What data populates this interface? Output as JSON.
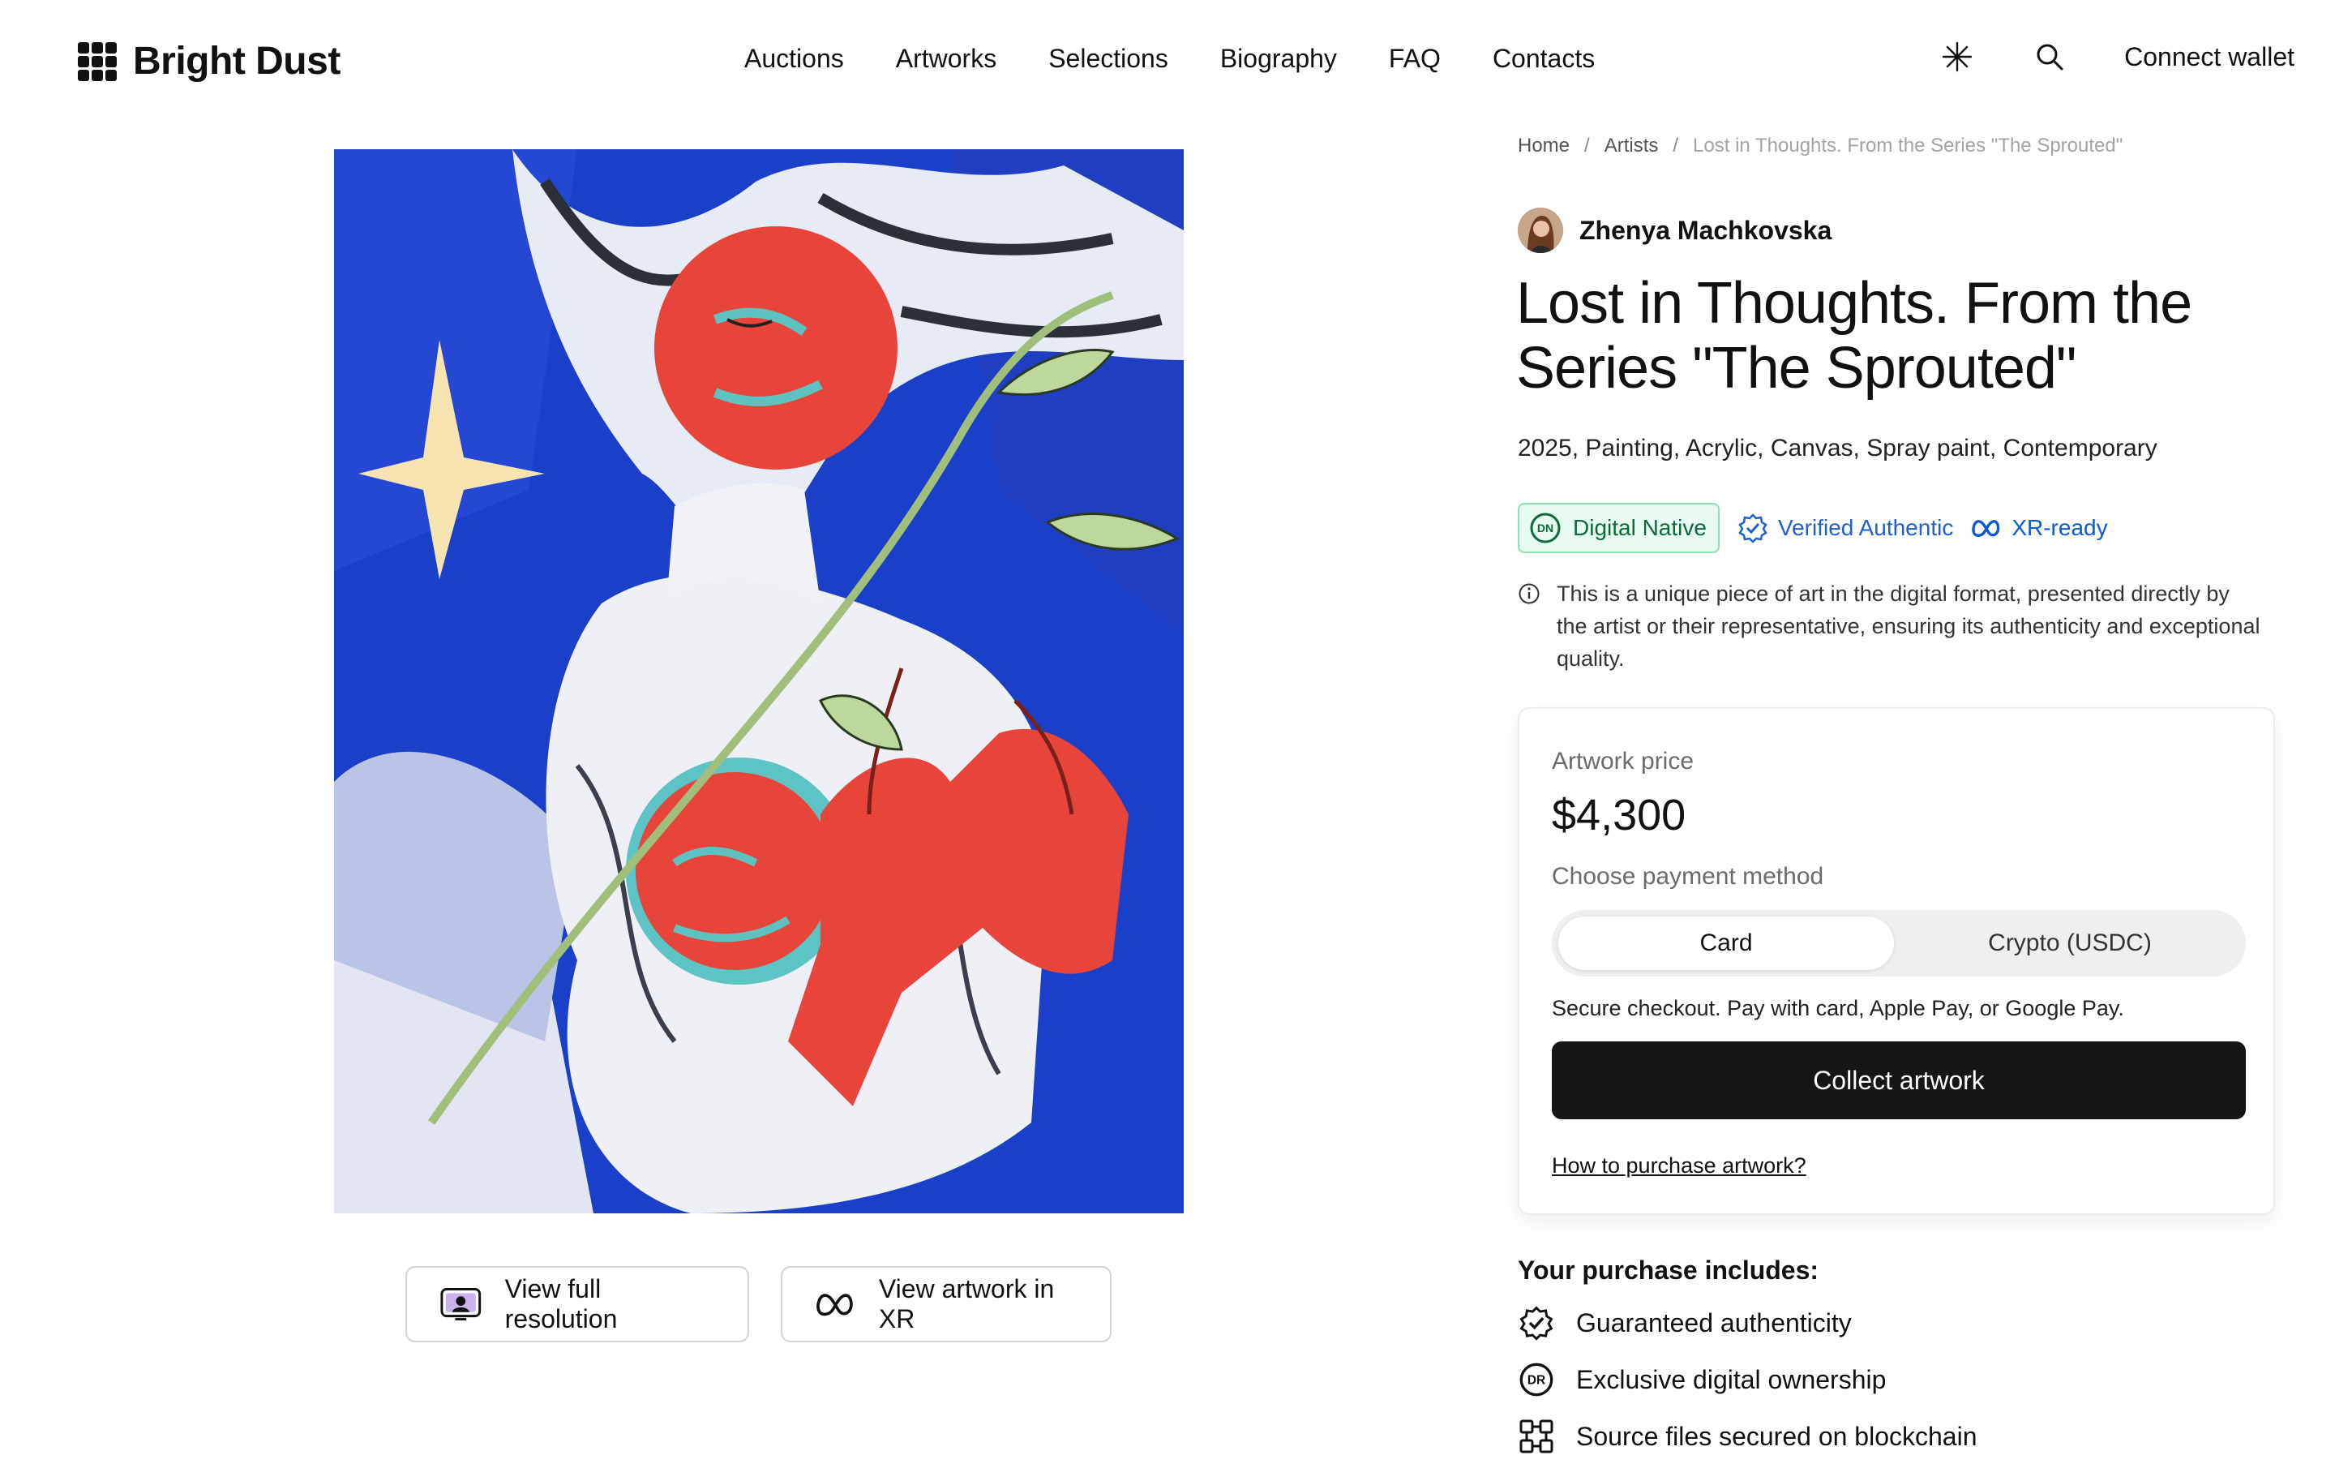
{
  "brand": {
    "name": "Bright Dust"
  },
  "nav": {
    "items": [
      "Auctions",
      "Artworks",
      "Selections",
      "Biography",
      "FAQ",
      "Contacts"
    ]
  },
  "header": {
    "wallet_label": "Connect wallet",
    "theme_icon": "sparkle-icon",
    "search_icon": "search-icon"
  },
  "breadcrumb": {
    "home": "Home",
    "sep": "/",
    "artists": "Artists",
    "current": "Lost in Thoughts. From the Series \"The Sprouted\""
  },
  "artist": {
    "name": "Zhenya Machkovska"
  },
  "artwork": {
    "title": "Lost in Thoughts. From the Series \"The Sprouted\"",
    "meta": "2025, Painting, Acrylic, Canvas, Spray paint, Contemporary",
    "view_full_label": "View full resolution",
    "view_xr_label": "View artwork in XR"
  },
  "badges": {
    "digital_native": "Digital Native",
    "dn_mark": "DN",
    "verified": "Verified Authentic",
    "xr": "XR-ready"
  },
  "info": {
    "text": "This is a unique piece of art in the digital format, presented directly by the artist or their representative, ensuring its authenticity and exceptional quality."
  },
  "purchase": {
    "price_label": "Artwork price",
    "price": "$4,300",
    "payment_label": "Choose payment method",
    "methods": [
      "Card",
      "Crypto (USDC)"
    ],
    "selected_method": "Card",
    "secure_text": "Secure checkout. Pay with card, Apple Pay, or Google Pay.",
    "collect_label": "Collect artwork",
    "howto_label": "How to purchase artwork?"
  },
  "includes": {
    "title": "Your purchase includes:",
    "dr_mark": "DR",
    "items": [
      "Guaranteed authenticity",
      "Exclusive digital ownership",
      "Source files secured on blockchain"
    ]
  },
  "colors": {
    "accent_dark": "#161616",
    "digital_native_green": "#0b6b3a",
    "verified_blue": "#1f5fd6",
    "painting_blue": "#1a3fc9",
    "painting_red": "#e8453a"
  }
}
